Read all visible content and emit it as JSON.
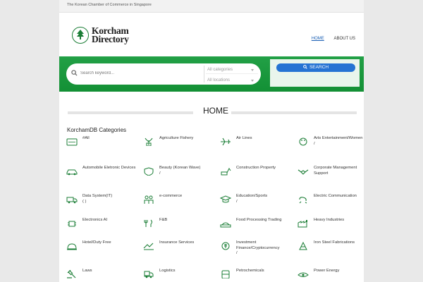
{
  "topbar": {
    "tagline": "The Korean Chamber of Commerce in Singapore"
  },
  "logo": {
    "line1": "Korcham",
    "line2": "Directory"
  },
  "nav": [
    {
      "label": "HOME",
      "active": true
    },
    {
      "label": "ABOUT US",
      "active": false
    }
  ],
  "search": {
    "keyword_placeholder": "Search keyword...",
    "category_value": "All categories",
    "location_value": "All locations",
    "button_label": "SEARCH"
  },
  "page_title": "HOME",
  "categories_heading": "KorchamDB Categories",
  "colors": {
    "brand_green": "#1a9a3f",
    "search_blue": "#2573d3",
    "icon_green": "#1a7d35"
  },
  "categories": [
    {
      "label": "#All",
      "icon": "tag-icon"
    },
    {
      "label": "Agriculture Fishery",
      "icon": "plant-icon"
    },
    {
      "label": "Air Lines",
      "icon": "airplane-icon"
    },
    {
      "label": "Arts Entertainment/Women\n/",
      "icon": "palette-icon"
    },
    {
      "label": "Automobile Eletronic Devices",
      "icon": "car-icon"
    },
    {
      "label": "Beauty (Korean Wave)\n/",
      "icon": "shield-icon"
    },
    {
      "label": "Construction Property",
      "icon": "excavator-icon"
    },
    {
      "label": "Corporate Management Support",
      "icon": "handshake-icon"
    },
    {
      "label": "Data System(IT)\n(        )",
      "icon": "truck-icon"
    },
    {
      "label": "e-commerce",
      "icon": "people-icon"
    },
    {
      "label": "Education/Sports\n/",
      "icon": "graduation-icon"
    },
    {
      "label": "Electric Communication",
      "icon": "plug-icon"
    },
    {
      "label": "Electronics AI",
      "icon": "chip-icon"
    },
    {
      "label": "F&B",
      "icon": "cutlery-icon"
    },
    {
      "label": "Food Processing Trading",
      "icon": "bread-icon"
    },
    {
      "label": "Heavy Industries",
      "icon": "factory-icon"
    },
    {
      "label": "Hotel/Duty Free",
      "icon": "bell-icon"
    },
    {
      "label": "Insurance Services",
      "icon": "insurance-icon"
    },
    {
      "label": "Investment Finance/Cryptocurrency\n/",
      "icon": "finance-icon"
    },
    {
      "label": "Iron Steel Fabrications",
      "icon": "tower-icon"
    },
    {
      "label": "Laws",
      "icon": "gavel-icon"
    },
    {
      "label": "Logistics",
      "icon": "delivery-icon"
    },
    {
      "label": "Petrochemicals",
      "icon": "barrel-icon"
    },
    {
      "label": "Power Energy",
      "icon": "power-icon"
    }
  ]
}
